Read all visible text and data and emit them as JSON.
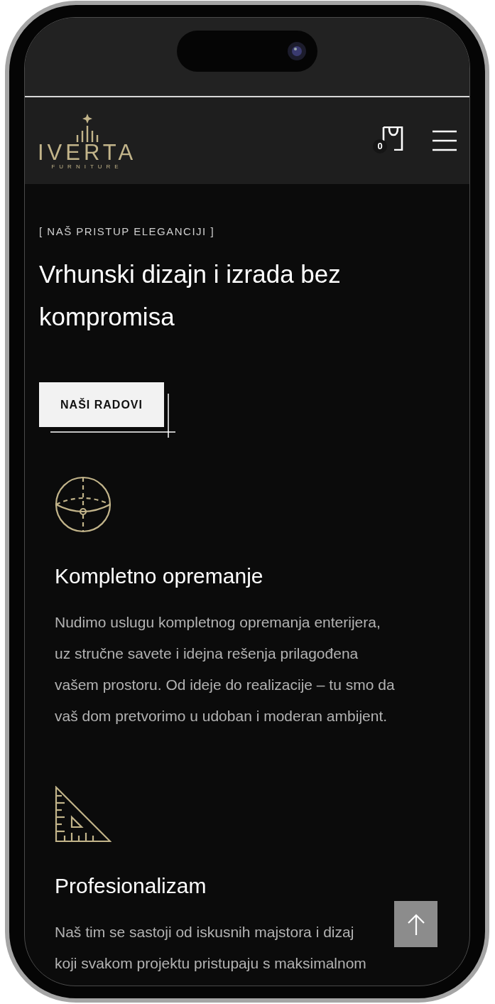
{
  "header": {
    "logo": {
      "name": "IVERTA",
      "tagline": "FURNITURE"
    },
    "cart_count": "0"
  },
  "hero": {
    "eyebrow": "[ NAŠ PRISTUP ELEGANCIJI ]",
    "title": "Vrhunski dizajn i izrada bez kompromisa",
    "button": "NAŠI RADOVI"
  },
  "features": [
    {
      "kind": "sphere",
      "title": "Kompletno opremanje",
      "lines": [
        "Nudimo uslugu kompletnog opremanja enterijera,",
        "uz stručne savete i idejna rešenja prilagođena",
        "vašem prostoru. Od ideje do realizacije – tu smo da",
        "vaš dom pretvorimo u udoban i moderan ambijent."
      ]
    },
    {
      "kind": "set-square",
      "title": "Profesionalizam",
      "lines": [
        "Naš tim se sastoji od iskusnih majstora i dizaj",
        "koji svakom projektu pristupaju s maksimalnom"
      ]
    }
  ]
}
